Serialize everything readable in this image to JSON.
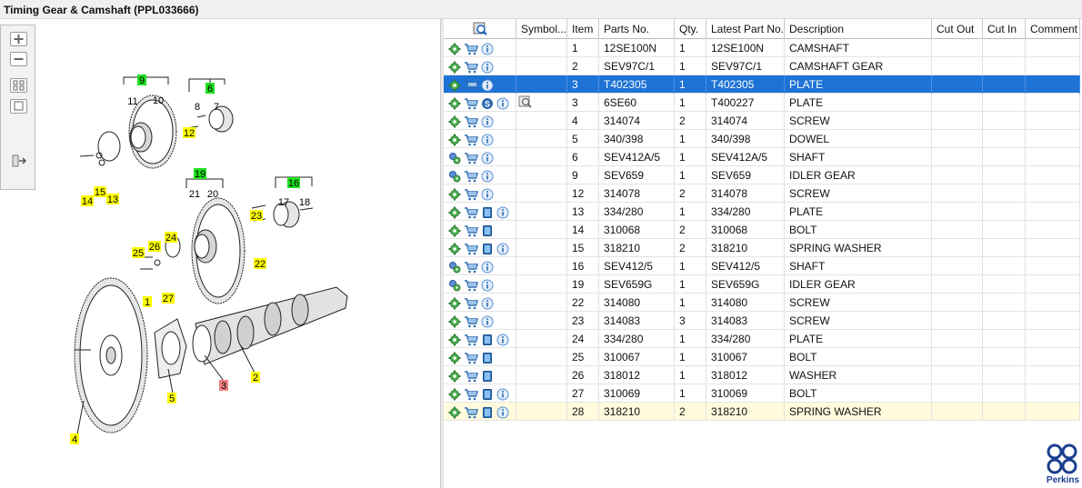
{
  "window": {
    "title": "Timing Gear & Camshaft (PPL033666)"
  },
  "columns": [
    "",
    "Symbol...",
    "Item",
    "Parts No.",
    "Qty.",
    "Latest Part No.",
    "Description",
    "Cut Out",
    "Cut In",
    "Comment"
  ],
  "rows": [
    {
      "item": "1",
      "part": "12SE100N",
      "qty": "1",
      "latest": "12SE100N",
      "desc": "CAMSHAFT",
      "icons": [
        "gear-green",
        "cart",
        "info"
      ]
    },
    {
      "item": "2",
      "part": "SEV97C/1",
      "qty": "1",
      "latest": "SEV97C/1",
      "desc": "CAMSHAFT GEAR",
      "icons": [
        "gear-green",
        "cart",
        "info"
      ]
    },
    {
      "item": "3",
      "part": "T402305",
      "qty": "1",
      "latest": "T402305",
      "desc": "PLATE",
      "icons": [
        "gear-green",
        "cart",
        "info"
      ],
      "selected": true
    },
    {
      "item": "3",
      "part": "6SE60",
      "qty": "1",
      "latest": "T400227",
      "desc": "PLATE",
      "icons": [
        "gear-green",
        "cart",
        "s",
        "info"
      ],
      "symbol": true
    },
    {
      "item": "4",
      "part": "314074",
      "qty": "2",
      "latest": "314074",
      "desc": "SCREW",
      "icons": [
        "gear-green",
        "cart",
        "info"
      ]
    },
    {
      "item": "5",
      "part": "340/398",
      "qty": "1",
      "latest": "340/398",
      "desc": "DOWEL",
      "icons": [
        "gear-green",
        "cart",
        "info"
      ]
    },
    {
      "item": "6",
      "part": "SEV412A/5",
      "qty": "1",
      "latest": "SEV412A/5",
      "desc": "SHAFT",
      "icons": [
        "gear-blue",
        "cart",
        "info"
      ]
    },
    {
      "item": "9",
      "part": "SEV659",
      "qty": "1",
      "latest": "SEV659",
      "desc": "IDLER GEAR",
      "icons": [
        "gear-blue",
        "cart",
        "info"
      ]
    },
    {
      "item": "12",
      "part": "314078",
      "qty": "2",
      "latest": "314078",
      "desc": "SCREW",
      "icons": [
        "gear-green",
        "cart",
        "info"
      ]
    },
    {
      "item": "13",
      "part": "334/280",
      "qty": "1",
      "latest": "334/280",
      "desc": "PLATE",
      "icons": [
        "gear-green",
        "cart",
        "book",
        "info"
      ]
    },
    {
      "item": "14",
      "part": "310068",
      "qty": "2",
      "latest": "310068",
      "desc": "BOLT",
      "icons": [
        "gear-green",
        "cart",
        "book"
      ]
    },
    {
      "item": "15",
      "part": "318210",
      "qty": "2",
      "latest": "318210",
      "desc": "SPRING WASHER",
      "icons": [
        "gear-green",
        "cart",
        "book",
        "info"
      ]
    },
    {
      "item": "16",
      "part": "SEV412/5",
      "qty": "1",
      "latest": "SEV412/5",
      "desc": "SHAFT",
      "icons": [
        "gear-blue",
        "cart",
        "info"
      ]
    },
    {
      "item": "19",
      "part": "SEV659G",
      "qty": "1",
      "latest": "SEV659G",
      "desc": "IDLER GEAR",
      "icons": [
        "gear-blue",
        "cart",
        "info"
      ]
    },
    {
      "item": "22",
      "part": "314080",
      "qty": "1",
      "latest": "314080",
      "desc": "SCREW",
      "icons": [
        "gear-green",
        "cart",
        "info"
      ]
    },
    {
      "item": "23",
      "part": "314083",
      "qty": "3",
      "latest": "314083",
      "desc": "SCREW",
      "icons": [
        "gear-green",
        "cart",
        "info"
      ]
    },
    {
      "item": "24",
      "part": "334/280",
      "qty": "1",
      "latest": "334/280",
      "desc": "PLATE",
      "icons": [
        "gear-green",
        "cart",
        "book",
        "info"
      ]
    },
    {
      "item": "25",
      "part": "310067",
      "qty": "1",
      "latest": "310067",
      "desc": "BOLT",
      "icons": [
        "gear-green",
        "cart",
        "book"
      ]
    },
    {
      "item": "26",
      "part": "318012",
      "qty": "1",
      "latest": "318012",
      "desc": "WASHER",
      "icons": [
        "gear-green",
        "cart",
        "book"
      ]
    },
    {
      "item": "27",
      "part": "310069",
      "qty": "1",
      "latest": "310069",
      "desc": "BOLT",
      "icons": [
        "gear-green",
        "cart",
        "book",
        "info"
      ]
    },
    {
      "item": "28",
      "part": "318210",
      "qty": "2",
      "latest": "318210",
      "desc": "SPRING WASHER",
      "icons": [
        "gear-green",
        "cart",
        "book",
        "info"
      ],
      "highlight": true
    }
  ],
  "callouts": [
    {
      "label": "9",
      "color": "green"
    },
    {
      "label": "6",
      "color": "green"
    },
    {
      "label": "19",
      "color": "green"
    },
    {
      "label": "16",
      "color": "green"
    },
    {
      "label": "12",
      "color": "yellow"
    },
    {
      "label": "15",
      "color": "yellow"
    },
    {
      "label": "14",
      "color": "yellow"
    },
    {
      "label": "13",
      "color": "yellow"
    },
    {
      "label": "23",
      "color": "yellow"
    },
    {
      "label": "22",
      "color": "yellow"
    },
    {
      "label": "24",
      "color": "yellow"
    },
    {
      "label": "26",
      "color": "yellow"
    },
    {
      "label": "25",
      "color": "yellow"
    },
    {
      "label": "27",
      "color": "yellow"
    },
    {
      "label": "1",
      "color": "yellow"
    },
    {
      "label": "2",
      "color": "yellow"
    },
    {
      "label": "4",
      "color": "yellow"
    },
    {
      "label": "5",
      "color": "yellow"
    },
    {
      "label": "3",
      "color": "red"
    }
  ],
  "plain_labels": [
    "11",
    "10",
    "8",
    "7",
    "21",
    "20",
    "17",
    "18"
  ],
  "brand": {
    "name": "Perkins",
    "color": "#1b3f8f"
  },
  "colors": {
    "selection": "#1e73d6",
    "highlight_row": "#fffbdc",
    "callout_yellow": "#ffff00",
    "callout_green": "#1fe01f",
    "callout_red": "#f08080"
  }
}
